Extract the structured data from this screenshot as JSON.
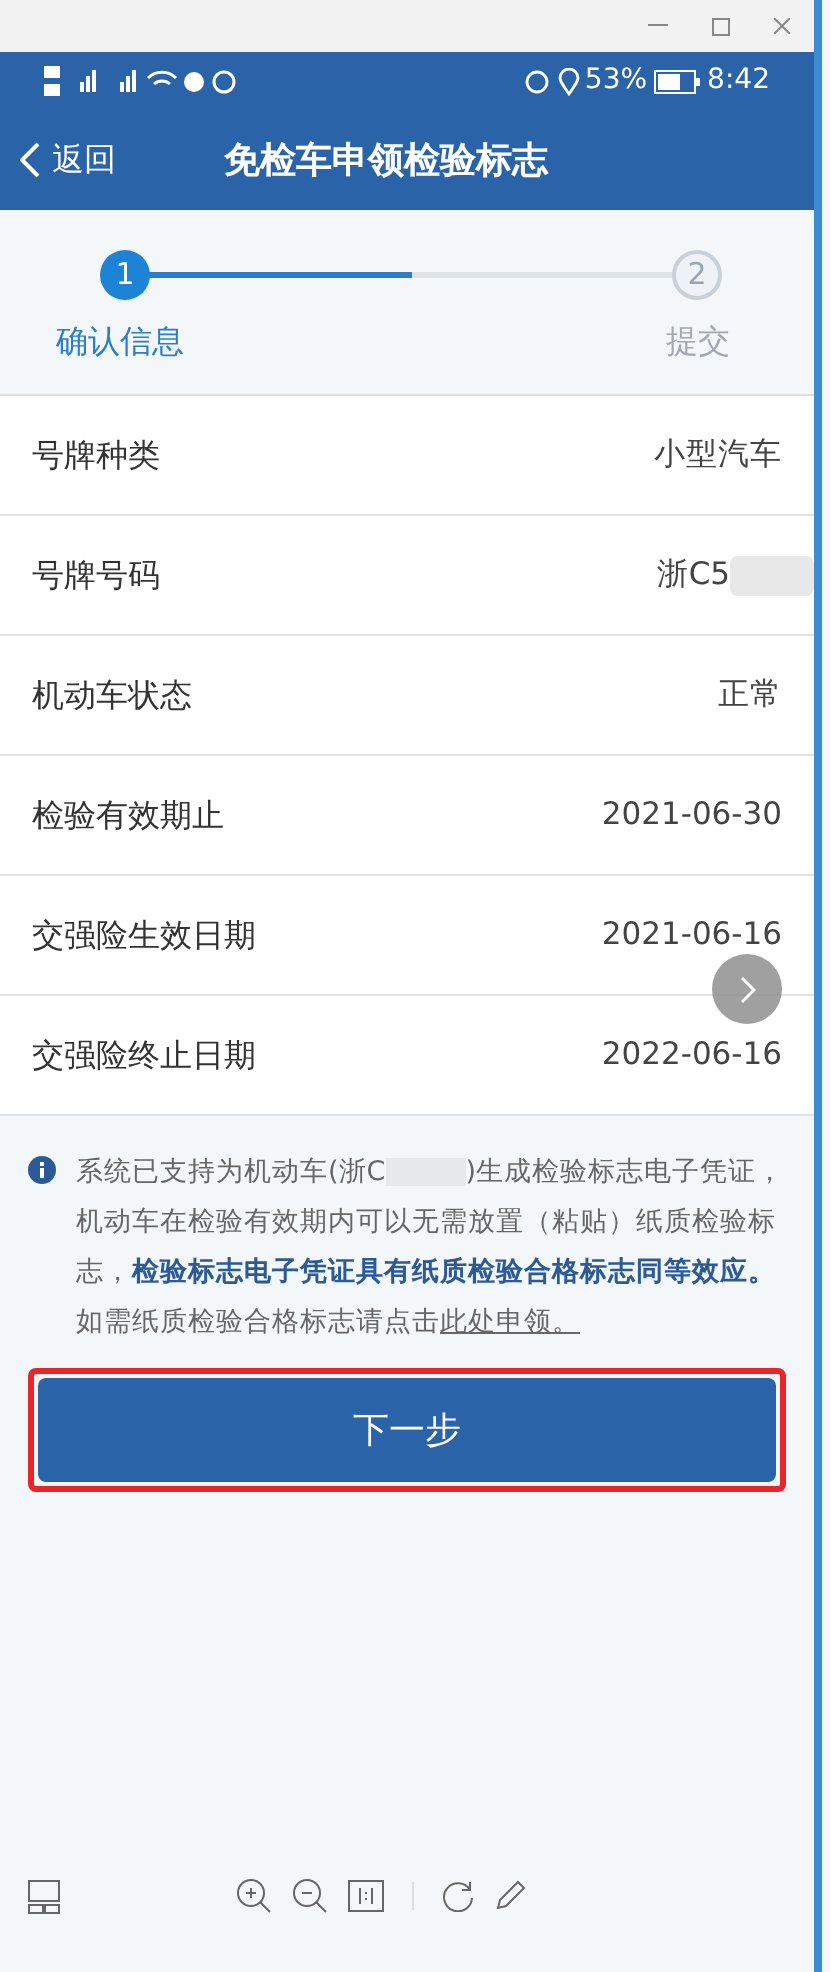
{
  "status_bar": {
    "battery": "53%",
    "time": "8:42"
  },
  "header": {
    "back": "返回",
    "title": "免检车申领检验标志"
  },
  "steps": {
    "level": 0.5,
    "items": [
      {
        "number": "1",
        "label": "确认信息",
        "selected": true
      },
      {
        "number": "2",
        "label": "提交",
        "selected": false
      }
    ]
  },
  "rows": [
    {
      "label": "号牌种类",
      "value": "小型汽车",
      "redacted": false
    },
    {
      "label": "号牌号码",
      "value": "浙C5",
      "redacted": true
    },
    {
      "label": "机动车状态",
      "value": "正常",
      "redacted": false
    },
    {
      "label": "检验有效期止",
      "value": "2021-06-30",
      "redacted": false
    },
    {
      "label": "交强险生效日期",
      "value": "2021-06-16",
      "redacted": false
    },
    {
      "label": "交强险终止日期",
      "value": "2022-06-16",
      "redacted": false
    }
  ],
  "note": {
    "before": "系统已支持为机动车(浙C",
    "after": ")生成检验标志电子凭证，机动车在检验有效期内可以无需放置（粘贴）纸质检验标志，**检验标志电子凭证具有纸质检验合格标志同等效应。**如需纸质检验合格标志请点击",
    "link": "此处申领。"
  },
  "next_button": {
    "label": "下一步",
    "highlighted": true
  }
}
